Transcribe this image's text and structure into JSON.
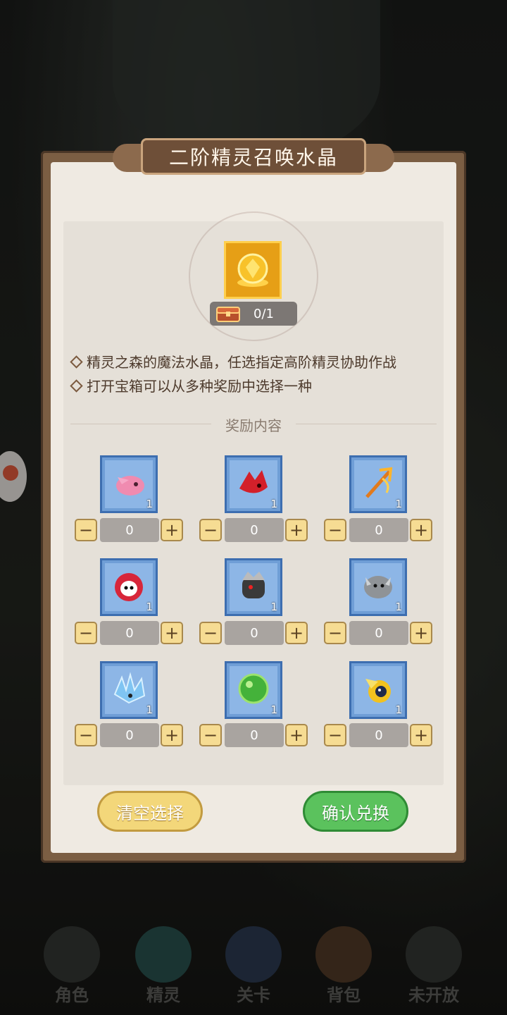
{
  "dialog": {
    "title": "二阶精灵召唤水晶",
    "crystal_count": "0/1",
    "descriptions": [
      "精灵之森的魔法水晶，任选指定高阶精灵协助作战",
      "打开宝箱可以从多种奖励中选择一种"
    ],
    "section_title": "奖励内容",
    "items": [
      {
        "icon": "pink-bird-spirit-icon",
        "qty": "1",
        "value": "0"
      },
      {
        "icon": "red-dragon-spirit-icon",
        "qty": "1",
        "value": "0"
      },
      {
        "icon": "fire-trident-icon",
        "qty": "1",
        "value": "0"
      },
      {
        "icon": "red-owl-spirit-icon",
        "qty": "1",
        "value": "0"
      },
      {
        "icon": "black-armor-spirit-icon",
        "qty": "1",
        "value": "0"
      },
      {
        "icon": "grey-beast-spirit-icon",
        "qty": "1",
        "value": "0"
      },
      {
        "icon": "ice-crystal-spirit-icon",
        "qty": "1",
        "value": "0"
      },
      {
        "icon": "green-orb-spirit-icon",
        "qty": "1",
        "value": "0"
      },
      {
        "icon": "thunder-spirit-icon",
        "qty": "1",
        "value": "0"
      }
    ],
    "minus_label": "−",
    "plus_label": "+",
    "clear_button": "清空选择",
    "confirm_button": "确认兑换"
  },
  "nav": {
    "items": [
      "角色",
      "精灵",
      "关卡",
      "背包",
      "未开放"
    ]
  },
  "colors": {
    "item_card": "#6f9ed6",
    "confirm": "#5bc25d",
    "clear": "#f3d77a"
  }
}
